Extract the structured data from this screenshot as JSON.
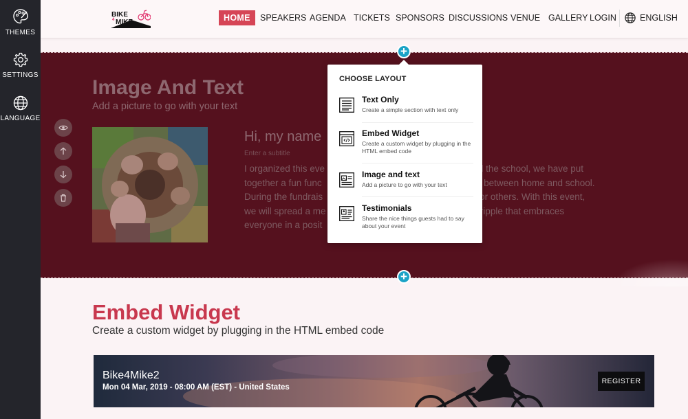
{
  "sidebar": {
    "items": [
      {
        "label": "THEMES",
        "icon": "palette-icon"
      },
      {
        "label": "SETTINGS",
        "icon": "gear-icon"
      },
      {
        "label": "LANGUAGE",
        "icon": "globe-icon"
      }
    ]
  },
  "header": {
    "logo_text_top": "BIKE",
    "logo_text_bottom": "MIKE",
    "logo_number": "4",
    "nav": [
      {
        "label": "HOME",
        "active": true
      },
      {
        "label": "SPEAKERS"
      },
      {
        "label": "AGENDA"
      },
      {
        "label": "TICKETS"
      },
      {
        "label": "SPONSORS"
      },
      {
        "label": "DISCUSSIONS"
      },
      {
        "label": "VENUE"
      },
      {
        "label": "GALLERY"
      },
      {
        "label": "LOGIN"
      }
    ],
    "language": "ENGLISH"
  },
  "image_text_section": {
    "title": "Image And Text",
    "subtitle": "Add a picture to go with your text",
    "heading": "Hi, my name",
    "subtitle_placeholder": "Enter a subtitle",
    "paragraph_lines": [
      "I organized this eve                                         ssmates and the school, we have put",
      "together a fun func                                           ck and forth between home and school.",
      "During the fundrais                                           oing good for others. With this event,",
      "we will spread a me                                          t creates a ripple that embraces",
      "everyone in a posit"
    ],
    "controls": [
      "eye-icon",
      "arrow-up-icon",
      "arrow-down-icon",
      "trash-icon"
    ]
  },
  "choose_layout": {
    "title": "CHOOSE LAYOUT",
    "options": [
      {
        "name": "Text Only",
        "desc": "Create a simple section with text only"
      },
      {
        "name": "Embed Widget",
        "desc": "Create a custom widget by plugging in the HTML embed code"
      },
      {
        "name": "Image and text",
        "desc": "Add a picture to go with your text"
      },
      {
        "name": "Testimonials",
        "desc": "Share the nice things guests had to say about your event"
      }
    ]
  },
  "embed_section": {
    "title": "Embed Widget",
    "subtitle": "Create a custom widget by plugging in the HTML embed code"
  },
  "event_card": {
    "name": "Bike4Mike2",
    "date": "Mon 04 Mar, 2019 - 08:00 AM (EST) - United States",
    "register_label": "REGISTER"
  },
  "colors": {
    "accent": "#d64556",
    "maroon": "#55111e",
    "plus": "#1ba3c6",
    "sidebar": "#24252b"
  }
}
